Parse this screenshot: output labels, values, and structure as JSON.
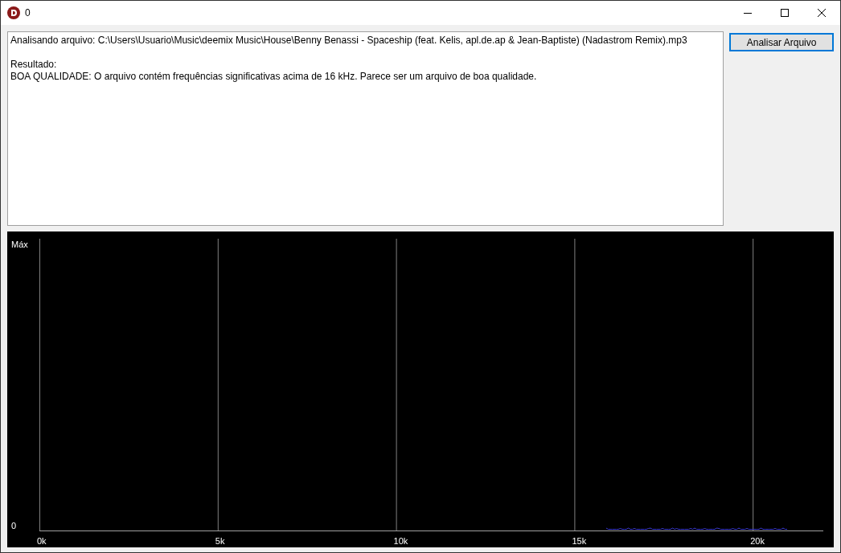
{
  "window": {
    "title": "0"
  },
  "output": {
    "paragraphs": [
      [
        "Analisando arquivo: C:\\Users\\Usuario\\Music\\deemix Music\\House\\Benny Benassi - Spaceship (feat. Kelis, apl.de.ap & Jean-Baptiste) (Nadastrom Remix).mp3"
      ],
      [
        "Resultado:",
        "BOA QUALIDADE: O arquivo contém frequências significativas acima de 16 kHz. Parece ser um arquivo de boa qualidade."
      ]
    ]
  },
  "analyze_button": {
    "label": "Analisar Arquivo",
    "focused": true
  },
  "spectrum": {
    "y_labels": [
      "Máx",
      "0"
    ],
    "x_labels": [
      "0k",
      "5k",
      "10k",
      "15k",
      "20k"
    ]
  }
}
